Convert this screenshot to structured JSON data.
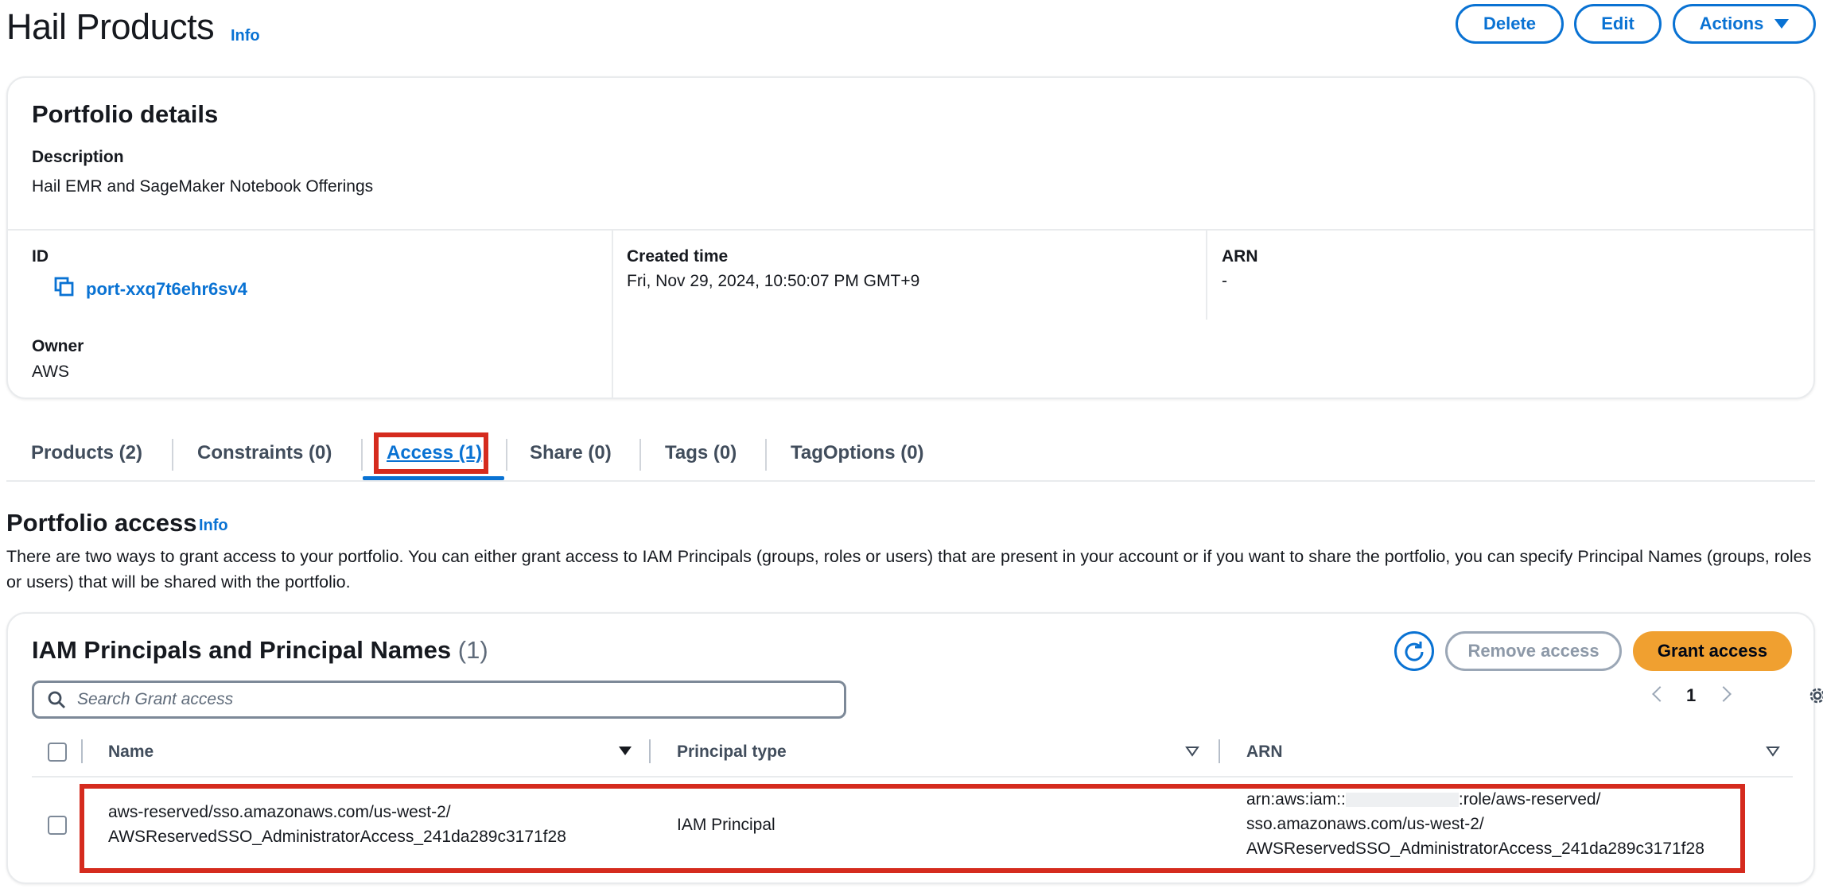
{
  "header": {
    "title": "Hail Products",
    "info": "Info",
    "buttons": {
      "delete": "Delete",
      "edit": "Edit",
      "actions": "Actions"
    }
  },
  "portfolio_details": {
    "heading": "Portfolio details",
    "description_label": "Description",
    "description_value": "Hail EMR and SageMaker Notebook Offerings",
    "id_label": "ID",
    "id_value": "port-xxq7t6ehr6sv4",
    "owner_label": "Owner",
    "owner_value": "AWS",
    "created_label": "Created time",
    "created_value": "Fri, Nov 29, 2024, 10:50:07 PM GMT+9",
    "arn_label": "ARN",
    "arn_value": "-"
  },
  "tabs": [
    {
      "label": "Products (2)"
    },
    {
      "label": "Constraints (0)"
    },
    {
      "label": "Access (1)",
      "active": true
    },
    {
      "label": "Share (0)"
    },
    {
      "label": "Tags (0)"
    },
    {
      "label": "TagOptions (0)"
    }
  ],
  "access_section": {
    "title": "Portfolio access",
    "info": "Info",
    "description": "There are two ways to grant access to your portfolio. You can either grant access to IAM Principals (groups, roles or users) that are present in your account or if you want to share the portfolio, you can specify Principal Names (groups, roles or users) that will be shared with the portfolio."
  },
  "principals_table": {
    "title": "IAM Principals and Principal Names",
    "count": "(1)",
    "remove_label": "Remove access",
    "grant_label": "Grant access",
    "search_placeholder": "Search Grant access",
    "page": "1",
    "columns": {
      "name": "Name",
      "type": "Principal type",
      "arn": "ARN"
    },
    "rows": [
      {
        "name_line1": "aws-reserved/sso.amazonaws.com/us-west-2/",
        "name_line2": "AWSReservedSSO_AdministratorAccess_241da289c3171f28",
        "type": "IAM Principal",
        "arn_line1_prefix": "arn:aws:iam::",
        "arn_line1_suffix": ":role/aws-reserved/",
        "arn_line2": "sso.amazonaws.com/us-west-2/",
        "arn_line3": "AWSReservedSSO_AdministratorAccess_241da289c3171f28"
      }
    ]
  },
  "colors": {
    "link": "#0972d3",
    "highlight": "#d52b1e",
    "primary_button": "#f0a030"
  },
  "icons": [
    "copy-icon",
    "refresh-icon",
    "search-icon",
    "chevron-left-icon",
    "chevron-right-icon",
    "gear-icon",
    "caret-down-icon",
    "sort-caret-icon"
  ]
}
